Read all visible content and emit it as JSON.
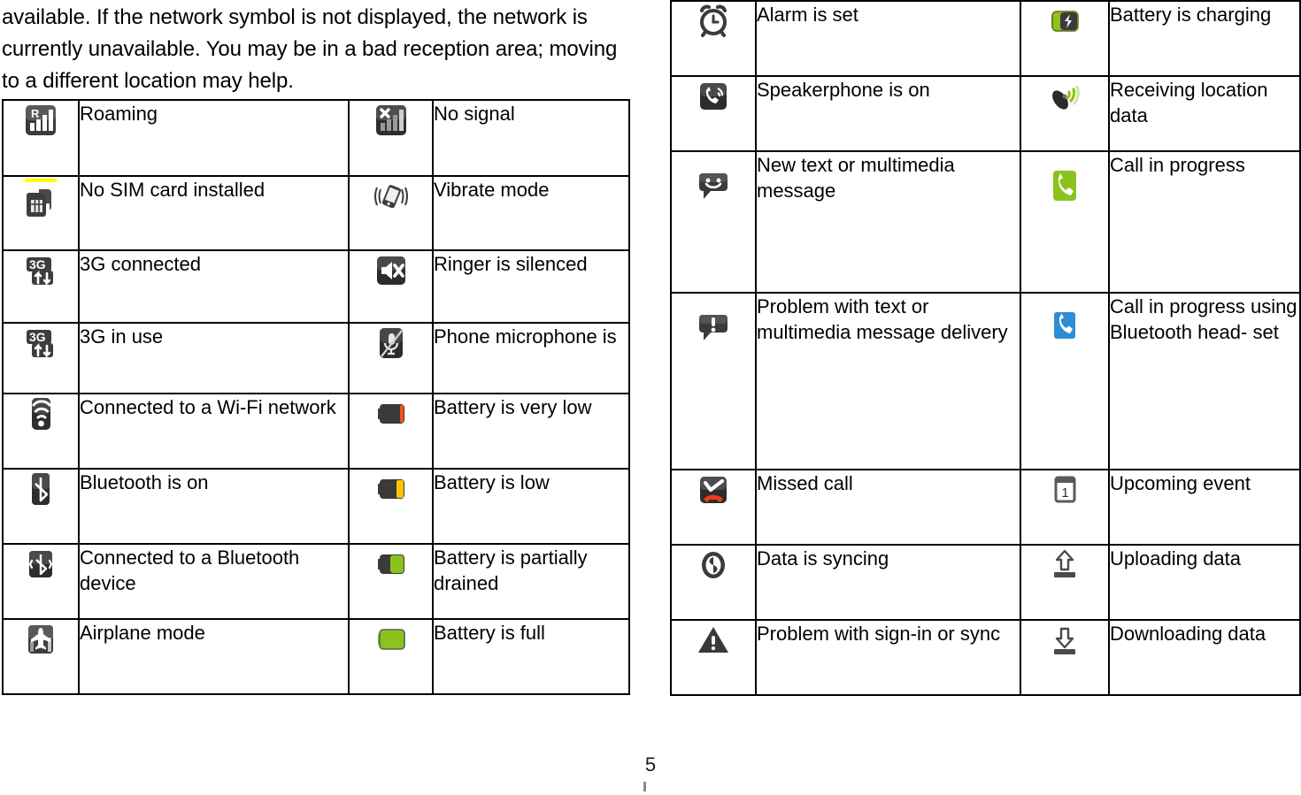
{
  "document": {
    "intro_paragraph": "available. If the network symbol is not displayed, the network is currently unavailable. You may be in a bad reception area; moving to a different location may help.",
    "page_number": "5"
  },
  "left_table": {
    "rows": [
      {
        "icon_a": "roaming-signal-icon",
        "label_a": "Roaming",
        "icon_b": "no-signal-icon",
        "label_b": "No signal"
      },
      {
        "icon_a": "no-sim-card-icon",
        "label_a": "No SIM card installed",
        "icon_b": "vibrate-mode-icon",
        "label_b": "Vibrate mode"
      },
      {
        "icon_a": "3g-connected-icon",
        "label_a": "3G connected",
        "icon_b": "ringer-silenced-icon",
        "label_b": "Ringer is silenced"
      },
      {
        "icon_a": "3g-in-use-icon",
        "label_a": "3G in use",
        "icon_b": "microphone-muted-icon",
        "label_b": "Phone microphone is"
      },
      {
        "icon_a": "wifi-connected-icon",
        "label_a": "Connected to a Wi-Fi network",
        "icon_b": "battery-very-low-icon",
        "label_b": "Battery is very low"
      },
      {
        "icon_a": "bluetooth-on-icon",
        "label_a": "Bluetooth is on",
        "icon_b": "battery-low-icon",
        "label_b": "Battery is low"
      },
      {
        "icon_a": "bluetooth-connected-icon",
        "label_a": "Connected to a Bluetooth device",
        "icon_b": "battery-partial-icon",
        "label_b": "Battery is partially drained"
      },
      {
        "icon_a": "airplane-mode-icon",
        "label_a": "Airplane mode",
        "icon_b": "battery-full-icon",
        "label_b": "Battery is full"
      }
    ]
  },
  "right_table": {
    "rows": [
      {
        "icon_a": "alarm-clock-icon",
        "label_a": "Alarm is set",
        "icon_b": "battery-charging-icon",
        "label_b": "Battery is charging"
      },
      {
        "icon_a": "speakerphone-icon",
        "label_a": "Speakerphone is on",
        "icon_b": "receiving-location-icon",
        "label_b": "Receiving location data"
      },
      {
        "icon_a": "new-message-icon",
        "label_a": "New text or multimedia message",
        "icon_b": "call-in-progress-icon",
        "label_b": "Call in progress"
      },
      {
        "icon_a": "message-problem-icon",
        "label_a": "Problem with text or multimedia message delivery",
        "icon_b": "call-bluetooth-icon",
        "label_b": "Call in progress using Bluetooth head- set"
      },
      {
        "icon_a": "missed-call-icon",
        "label_a": "Missed call",
        "icon_b": "upcoming-event-icon",
        "label_b": "Upcoming event"
      },
      {
        "icon_a": "data-syncing-icon",
        "label_a": "Data is syncing",
        "icon_b": "uploading-data-icon",
        "label_b": "Uploading data"
      },
      {
        "icon_a": "sign-in-problem-icon",
        "label_a": "Problem with sign-in or sync",
        "icon_b": "downloading-data-icon",
        "label_b": "Downloading data"
      }
    ]
  },
  "colors": {
    "battery_green": "#8cc21e",
    "battery_yellow": "#ffc400",
    "battery_orange": "#f05a19",
    "call_green": "#8cc21e",
    "call_blue": "#2a8fd4",
    "missed_call_red": "#ee3a1c",
    "sim_marker_yellow": "#ffff00",
    "icon_dark": "#3a3a3a",
    "border": "#000000"
  }
}
